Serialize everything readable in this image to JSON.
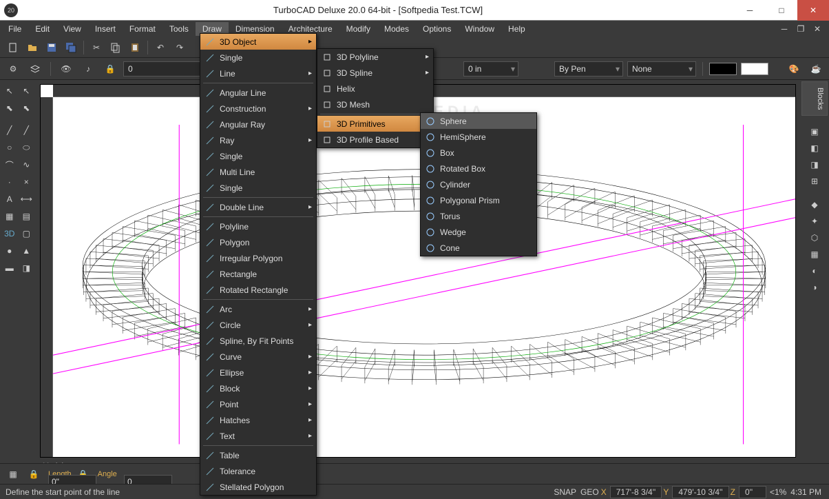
{
  "title": "TurboCAD Deluxe 20.0 64-bit - [Softpedia Test.TCW]",
  "app_icon_text": "20",
  "menubar": [
    "File",
    "Edit",
    "View",
    "Insert",
    "Format",
    "Tools",
    "Draw",
    "Dimension",
    "Architecture",
    "Modify",
    "Modes",
    "Options",
    "Window",
    "Help"
  ],
  "active_menu": "Draw",
  "property_row": {
    "layer_value": "0",
    "color_label": "Red",
    "width_value": "0 in",
    "pen": "By Pen",
    "style": "None"
  },
  "draw_menu": [
    {
      "label": "3D Object",
      "arrow": true,
      "hl": true
    },
    {
      "label": "Single"
    },
    {
      "label": "Line",
      "arrow": true
    },
    {
      "sep": true
    },
    {
      "label": "Angular Line"
    },
    {
      "label": "Construction",
      "arrow": true
    },
    {
      "label": "Angular Ray"
    },
    {
      "label": "Ray",
      "arrow": true
    },
    {
      "label": "Single"
    },
    {
      "label": "Multi Line"
    },
    {
      "label": "Single"
    },
    {
      "sep": true
    },
    {
      "label": "Double Line",
      "arrow": true
    },
    {
      "sep": true
    },
    {
      "label": "Polyline"
    },
    {
      "label": "Polygon"
    },
    {
      "label": "Irregular Polygon"
    },
    {
      "label": "Rectangle"
    },
    {
      "label": "Rotated Rectangle"
    },
    {
      "sep": true
    },
    {
      "label": "Arc",
      "arrow": true
    },
    {
      "label": "Circle",
      "arrow": true
    },
    {
      "label": "Spline, By Fit Points"
    },
    {
      "label": "Curve",
      "arrow": true
    },
    {
      "label": "Ellipse",
      "arrow": true
    },
    {
      "label": "Block",
      "arrow": true
    },
    {
      "label": "Point",
      "arrow": true
    },
    {
      "label": "Hatches",
      "arrow": true
    },
    {
      "label": "Text",
      "arrow": true
    },
    {
      "sep": true
    },
    {
      "label": "Table"
    },
    {
      "label": "Tolerance"
    },
    {
      "label": "Stellated Polygon"
    }
  ],
  "submenu_3d_object": [
    {
      "label": "3D Polyline",
      "arrow": true
    },
    {
      "label": "3D Spline",
      "arrow": true
    },
    {
      "label": "Helix"
    },
    {
      "label": "3D Mesh"
    },
    {
      "sep": true
    },
    {
      "label": "3D Primitives",
      "arrow": true,
      "hl": true
    },
    {
      "label": "3D Profile Based",
      "arrow": true
    }
  ],
  "submenu_primitives": [
    {
      "label": "Sphere",
      "hl2": true
    },
    {
      "label": "HemiSphere"
    },
    {
      "label": "Box"
    },
    {
      "label": "Rotated Box"
    },
    {
      "label": "Cylinder"
    },
    {
      "label": "Polygonal Prism"
    },
    {
      "label": "Torus"
    },
    {
      "label": "Wedge"
    },
    {
      "label": "Cone"
    }
  ],
  "inspector": {
    "length_label": "Length",
    "length_value": "0\"",
    "angle_label": "Angle",
    "angle_value": "0"
  },
  "statusbar": {
    "hint": "Define the start point of the line",
    "snap": "SNAP",
    "geo": "GEO",
    "x_label": "X",
    "x": "717'-8 3/4''",
    "y_label": "Y",
    "y": "479'-10 3/4''",
    "z_label": "Z",
    "z": "0''",
    "zoom": "<1%",
    "time": "4:31 PM"
  },
  "right_panel_label": "Blocks",
  "watermark": "SOFTPEDIA",
  "tabs": {
    "model": "Model"
  }
}
